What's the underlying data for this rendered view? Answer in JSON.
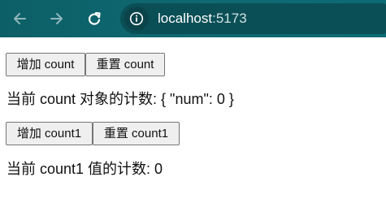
{
  "browser": {
    "url_host": "localhost",
    "url_port": ":5173",
    "back_icon": "arrow-left-icon",
    "forward_icon": "arrow-right-icon",
    "reload_icon": "reload-icon",
    "site_info_icon": "info-icon"
  },
  "page": {
    "row1": {
      "increase_label": "增加 count",
      "reset_label": "重置 count",
      "status_text": "当前 count 对象的计数: { \"num\": 0 }"
    },
    "row2": {
      "increase_label": "增加 count1",
      "reset_label": "重置 count1",
      "status_text": "当前 count1 值的计数: 0"
    }
  },
  "colors": {
    "toolbar": "#0e6a73",
    "address_bar": "#0b4f56",
    "button_bg": "#efefef",
    "button_border": "#767676"
  }
}
